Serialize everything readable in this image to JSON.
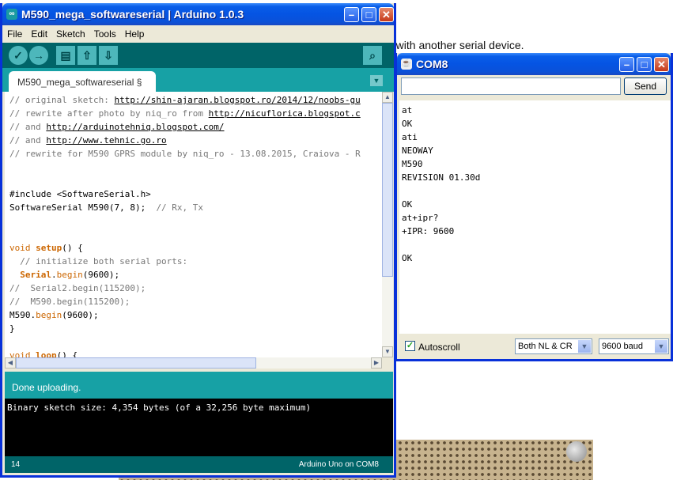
{
  "background": {
    "text": "e with another serial device."
  },
  "arduino": {
    "title": "M590_mega_softwareserial | Arduino 1.0.3",
    "menu": [
      "File",
      "Edit",
      "Sketch",
      "Tools",
      "Help"
    ],
    "toolbar": {
      "verify_glyph": "✓",
      "upload_glyph": "→",
      "new_glyph": "▤",
      "open_glyph": "⇧",
      "save_glyph": "⇩",
      "monitor_glyph": "⌕"
    },
    "tab_label": "M590_mega_softwareserial §",
    "code": {
      "c1a": "// original sketch: ",
      "c1b": "http://shin-ajaran.blogspot.ro/2014/12/noobs-gu",
      "c2a": "// rewrite after photo by niq_ro from ",
      "c2b": "http://nicuflorica.blogspot.c",
      "c3a": "// and ",
      "c3b": "http://arduinotehniq.blogspot.com/",
      "c4a": "// and ",
      "c4b": "http://www.tehnic.go.ro",
      "c5": "// rewrite for M590 GPRS module by niq_ro - 13.08.2015, Craiova - R",
      "inc": "#include <SoftwareSerial.h>",
      "ss_decl": "SoftwareSerial M590(7, 8);  ",
      "ss_cmt": "// Rx, Tx",
      "void1": "void",
      "setup": "setup",
      "setup_rest": "() {",
      "init_cmt": "  // initialize both serial ports:",
      "serial_kw": "Serial",
      "dot": ".",
      "begin_kw": "begin",
      "serial_rest": "(9600);",
      "s2_cmt": "//  Serial2.begin(115200);",
      "m590_cmt": "//  M590.begin(115200);",
      "m590": "M590",
      "m590_rest": "(9600);",
      "close": "}",
      "void2": "void",
      "loop": "loop",
      "loop_rest": "() {"
    },
    "status": "Done uploading.",
    "console": "Binary sketch size: 4,354 bytes (of a 32,256 byte maximum)",
    "line_number": "14",
    "board": "Arduino Uno on COM8"
  },
  "com8": {
    "title": "COM8",
    "input_value": "",
    "send_label": "Send",
    "output": "at\nOK\nati\nNEOWAY\nM590\nREVISION 01.30d\n\nOK\nat+ipr?\n+IPR: 9600\n\nOK",
    "autoscroll_label": "Autoscroll",
    "autoscroll_checked": true,
    "line_ending": "Both NL & CR",
    "baud": "9600 baud"
  }
}
